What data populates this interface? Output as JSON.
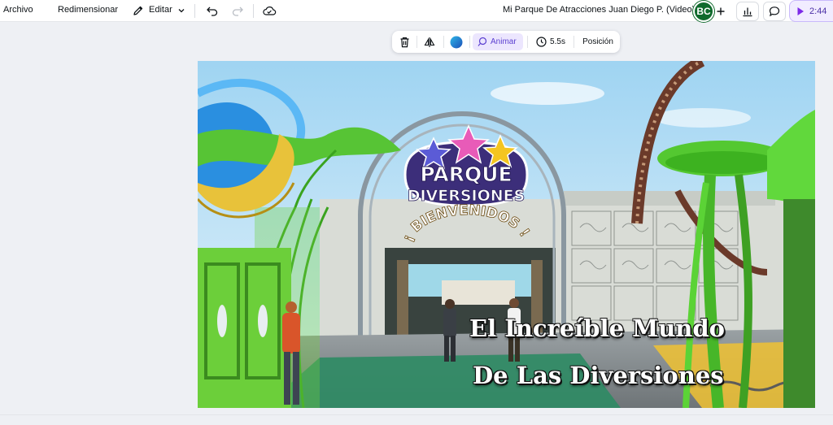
{
  "topbar": {
    "file_menu": "Archivo",
    "resize_menu": "Redimensionar",
    "edit_menu": "Editar",
    "document_title": "Mi Parque De Atracciones Juan Diego P. (Video)",
    "avatar_initials": "BC",
    "play_time": "2:44",
    "icons": [
      "pencil-icon",
      "chevron-down-icon",
      "undo-icon",
      "redo-icon",
      "cloud-saved-icon",
      "plus-icon",
      "chart-icon",
      "comment-icon",
      "play-icon"
    ]
  },
  "element_toolbar": {
    "animate_label": "Animar",
    "duration_label": "5.5s",
    "position_label": "Posición",
    "icons": [
      "trash-icon",
      "flip-icon",
      "color-icon",
      "animate-icon",
      "clock-icon"
    ]
  },
  "canvas": {
    "sign": {
      "line1": "PARQUE",
      "line2": "DIVERSIONES",
      "arc_text": "¡ BIENVENIDOS !"
    },
    "title_line1": "El Increíble Mundo",
    "title_line2": "De Las Diversiones"
  },
  "colors": {
    "accent_purple": "#8b3dff",
    "avatar_green": "#0f6a2c",
    "sky": "#bfe3f6",
    "tree_green": "#5dcf36"
  }
}
